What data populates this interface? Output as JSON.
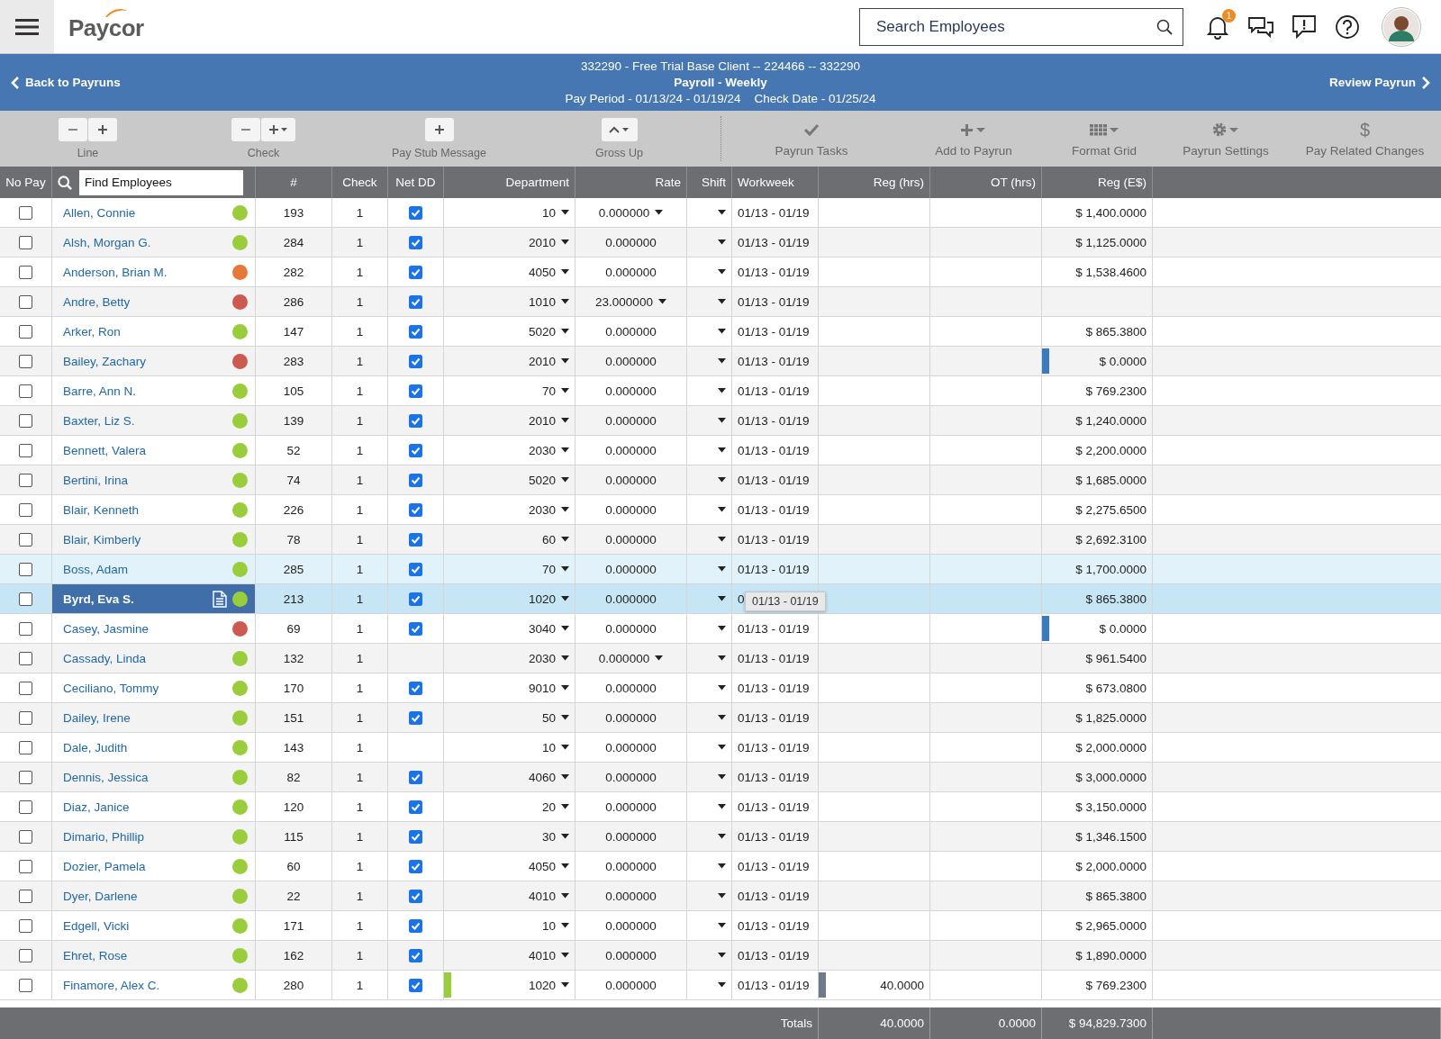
{
  "topbar": {
    "logo": "Paycor",
    "search": {
      "placeholder": "Search Employees"
    },
    "notifications": "1"
  },
  "header": {
    "back": "Back to Payruns",
    "lines": [
      "332290 - Free Trial Base Client -- 224466 -- 332290",
      "Payroll - Weekly",
      "Pay Period - 01/13/24 - 01/19/24    Check Date - 01/25/24"
    ],
    "next": "Review Payrun"
  },
  "toolbar": {
    "groups": [
      {
        "label": "Line"
      },
      {
        "label": "Check"
      },
      {
        "label": "Pay Stub Message"
      },
      {
        "label": "Gross Up"
      }
    ],
    "actions": [
      {
        "label": "Payrun Tasks"
      },
      {
        "label": "Add to Payrun"
      },
      {
        "label": "Format Grid"
      },
      {
        "label": "Payrun Settings"
      },
      {
        "label": "Pay Related Changes",
        "glyph": "$"
      }
    ]
  },
  "table": {
    "columns": [
      "No Pay",
      "#",
      "Check",
      "Net DD",
      "Department",
      "Rate",
      "Shift",
      "Workweek",
      "Reg (hrs)",
      "OT (hrs)",
      "Reg (E$)"
    ],
    "find": {
      "placeholder": "Find Employees"
    },
    "rows": [
      {
        "name": "Allen, Connie",
        "color": "#9acd3c",
        "num": "193",
        "check": "1",
        "net_dd": true,
        "dept": "10",
        "rate": "0.000000",
        "rate_menu": true,
        "workweek": "01/13 - 01/19",
        "reg_e": "$ 1,400.0000",
        "hovered": false,
        "selected": false
      },
      {
        "name": "Alsh, Morgan G.",
        "color": "#9acd3c",
        "num": "284",
        "check": "1",
        "net_dd": true,
        "dept": "2010",
        "rate": "0.000000",
        "workweek": "01/13 - 01/19",
        "reg_e": "$ 1,125.0000",
        "hovered": false,
        "selected": false
      },
      {
        "name": "Anderson, Brian M.",
        "color": "#e5793a",
        "num": "282",
        "check": "1",
        "net_dd": true,
        "dept": "4050",
        "rate": "0.000000",
        "workweek": "01/13 - 01/19",
        "reg_e": "$ 1,538.4600",
        "hovered": false,
        "selected": false
      },
      {
        "name": "Andre, Betty",
        "color": "#cc5a50",
        "num": "286",
        "check": "1",
        "net_dd": true,
        "dept": "1010",
        "rate": "23.000000",
        "rate_menu": true,
        "workweek": "01/13 - 01/19",
        "hovered": false,
        "selected": false
      },
      {
        "name": "Arker, Ron",
        "color": "#9acd3c",
        "num": "147",
        "check": "1",
        "net_dd": true,
        "dept": "5020",
        "rate": "0.000000",
        "workweek": "01/13 - 01/19",
        "reg_e": "$ 865.3800",
        "hovered": false,
        "selected": false
      },
      {
        "name": "Bailey, Zachary",
        "color": "#cc5a50",
        "num": "283",
        "check": "1",
        "net_dd": true,
        "dept": "2010",
        "rate": "0.000000",
        "workweek": "01/13 - 01/19",
        "reg_e": "$ 0.0000",
        "flag_pay": true,
        "hovered": false,
        "selected": false
      },
      {
        "name": "Barre, Ann N.",
        "color": "#9acd3c",
        "num": "105",
        "check": "1",
        "net_dd": true,
        "dept": "70",
        "rate": "0.000000",
        "workweek": "01/13 - 01/19",
        "reg_e": "$ 769.2300",
        "hovered": false,
        "selected": false
      },
      {
        "name": "Baxter, Liz S.",
        "color": "#9acd3c",
        "num": "139",
        "check": "1",
        "net_dd": true,
        "dept": "2010",
        "rate": "0.000000",
        "workweek": "01/13 - 01/19",
        "reg_e": "$ 1,240.0000",
        "hovered": false,
        "selected": false
      },
      {
        "name": "Bennett, Valera",
        "color": "#9acd3c",
        "num": "52",
        "check": "1",
        "net_dd": true,
        "dept": "2030",
        "rate": "0.000000",
        "workweek": "01/13 - 01/19",
        "reg_e": "$ 2,200.0000",
        "hovered": false,
        "selected": false
      },
      {
        "name": "Bertini, Irina",
        "color": "#9acd3c",
        "num": "74",
        "check": "1",
        "net_dd": true,
        "dept": "5020",
        "rate": "0.000000",
        "workweek": "01/13 - 01/19",
        "reg_e": "$ 1,685.0000",
        "hovered": false,
        "selected": false
      },
      {
        "name": "Blair, Kenneth",
        "color": "#9acd3c",
        "num": "226",
        "check": "1",
        "net_dd": true,
        "dept": "2030",
        "rate": "0.000000",
        "workweek": "01/13 - 01/19",
        "reg_e": "$ 2,275.6500",
        "hovered": false,
        "selected": false
      },
      {
        "name": "Blair, Kimberly",
        "color": "#9acd3c",
        "num": "78",
        "check": "1",
        "net_dd": true,
        "dept": "60",
        "rate": "0.000000",
        "workweek": "01/13 - 01/19",
        "reg_e": "$ 2,692.3100",
        "hovered": false,
        "selected": false
      },
      {
        "name": "Boss, Adam",
        "color": "#9acd3c",
        "num": "285",
        "check": "1",
        "net_dd": true,
        "dept": "70",
        "rate": "0.000000",
        "workweek": "01/13 - 01/19",
        "reg_e": "$ 1,700.0000",
        "hovered": true,
        "selected": false
      },
      {
        "name": "Byrd, Eva S.",
        "color": "#9acd3c",
        "num": "213",
        "check": "1",
        "net_dd": true,
        "dept": "1020",
        "rate": "0.000000",
        "workweek": "0",
        "tooltip": "01/13 - 01/19",
        "reg_e": "$ 865.3800",
        "hovered": false,
        "selected": true
      },
      {
        "name": "Casey, Jasmine",
        "color": "#cc5a50",
        "num": "69",
        "check": "1",
        "net_dd": true,
        "dept": "3040",
        "rate": "0.000000",
        "workweek": "01/13 - 01/19",
        "reg_e": "$ 0.0000",
        "flag_pay": true,
        "hovered": false,
        "selected": false
      },
      {
        "name": "Cassady, Linda",
        "color": "#9acd3c",
        "num": "132",
        "check": "1",
        "net_dd": false,
        "dept": "2030",
        "rate": "0.000000",
        "rate_menu": true,
        "workweek": "01/13 - 01/19",
        "reg_e": "$ 961.5400",
        "hovered": false,
        "selected": false
      },
      {
        "name": "Ceciliano, Tommy",
        "color": "#9acd3c",
        "num": "170",
        "check": "1",
        "net_dd": true,
        "dept": "9010",
        "rate": "0.000000",
        "workweek": "01/13 - 01/19",
        "reg_e": "$ 673.0800",
        "hovered": false,
        "selected": false
      },
      {
        "name": "Dailey, Irene",
        "color": "#9acd3c",
        "num": "151",
        "check": "1",
        "net_dd": true,
        "dept": "50",
        "rate": "0.000000",
        "workweek": "01/13 - 01/19",
        "reg_e": "$ 1,825.0000",
        "hovered": false,
        "selected": false
      },
      {
        "name": "Dale, Judith",
        "color": "#9acd3c",
        "num": "143",
        "check": "1",
        "net_dd": false,
        "dept": "10",
        "rate": "0.000000",
        "workweek": "01/13 - 01/19",
        "reg_e": "$ 2,000.0000",
        "hovered": false,
        "selected": false
      },
      {
        "name": "Dennis, Jessica",
        "color": "#9acd3c",
        "num": "82",
        "check": "1",
        "net_dd": true,
        "dept": "4060",
        "rate": "0.000000",
        "workweek": "01/13 - 01/19",
        "reg_e": "$ 3,000.0000",
        "hovered": false,
        "selected": false
      },
      {
        "name": "Diaz, Janice",
        "color": "#9acd3c",
        "num": "120",
        "check": "1",
        "net_dd": true,
        "dept": "20",
        "rate": "0.000000",
        "workweek": "01/13 - 01/19",
        "reg_e": "$ 3,150.0000",
        "hovered": false,
        "selected": false
      },
      {
        "name": "Dimario, Phillip",
        "color": "#9acd3c",
        "num": "115",
        "check": "1",
        "net_dd": true,
        "dept": "30",
        "rate": "0.000000",
        "workweek": "01/13 - 01/19",
        "reg_e": "$ 1,346.1500",
        "hovered": false,
        "selected": false
      },
      {
        "name": "Dozier, Pamela",
        "color": "#9acd3c",
        "num": "60",
        "check": "1",
        "net_dd": true,
        "dept": "4050",
        "rate": "0.000000",
        "workweek": "01/13 - 01/19",
        "reg_e": "$ 2,000.0000",
        "hovered": false,
        "selected": false
      },
      {
        "name": "Dyer, Darlene",
        "color": "#9acd3c",
        "num": "22",
        "check": "1",
        "net_dd": true,
        "dept": "4010",
        "rate": "0.000000",
        "workweek": "01/13 - 01/19",
        "reg_e": "$ 865.3800",
        "hovered": false,
        "selected": false
      },
      {
        "name": "Edgell, Vicki",
        "color": "#9acd3c",
        "num": "171",
        "check": "1",
        "net_dd": true,
        "dept": "10",
        "rate": "0.000000",
        "workweek": "01/13 - 01/19",
        "reg_e": "$ 2,965.0000",
        "hovered": false,
        "selected": false
      },
      {
        "name": "Ehret, Rose",
        "color": "#9acd3c",
        "num": "162",
        "check": "1",
        "net_dd": true,
        "dept": "4010",
        "rate": "0.000000",
        "workweek": "01/13 - 01/19",
        "reg_e": "$ 1,890.0000",
        "hovered": false,
        "selected": false
      },
      {
        "name": "Finamore, Alex C.",
        "color": "#9acd3c",
        "num": "280",
        "check": "1",
        "net_dd": true,
        "dept": "1020",
        "rate": "0.000000",
        "workweek": "01/13 - 01/19",
        "reg_hrs": "40.0000",
        "reg_e": "$ 769.2300",
        "flag_dept": true,
        "flag_hours": true,
        "hovered": false,
        "selected": false
      }
    ],
    "totals": {
      "label": "Totals",
      "reg_hrs": "40.0000",
      "ot_hrs": "0.0000",
      "reg_e": "$ 94,829.7300"
    }
  }
}
